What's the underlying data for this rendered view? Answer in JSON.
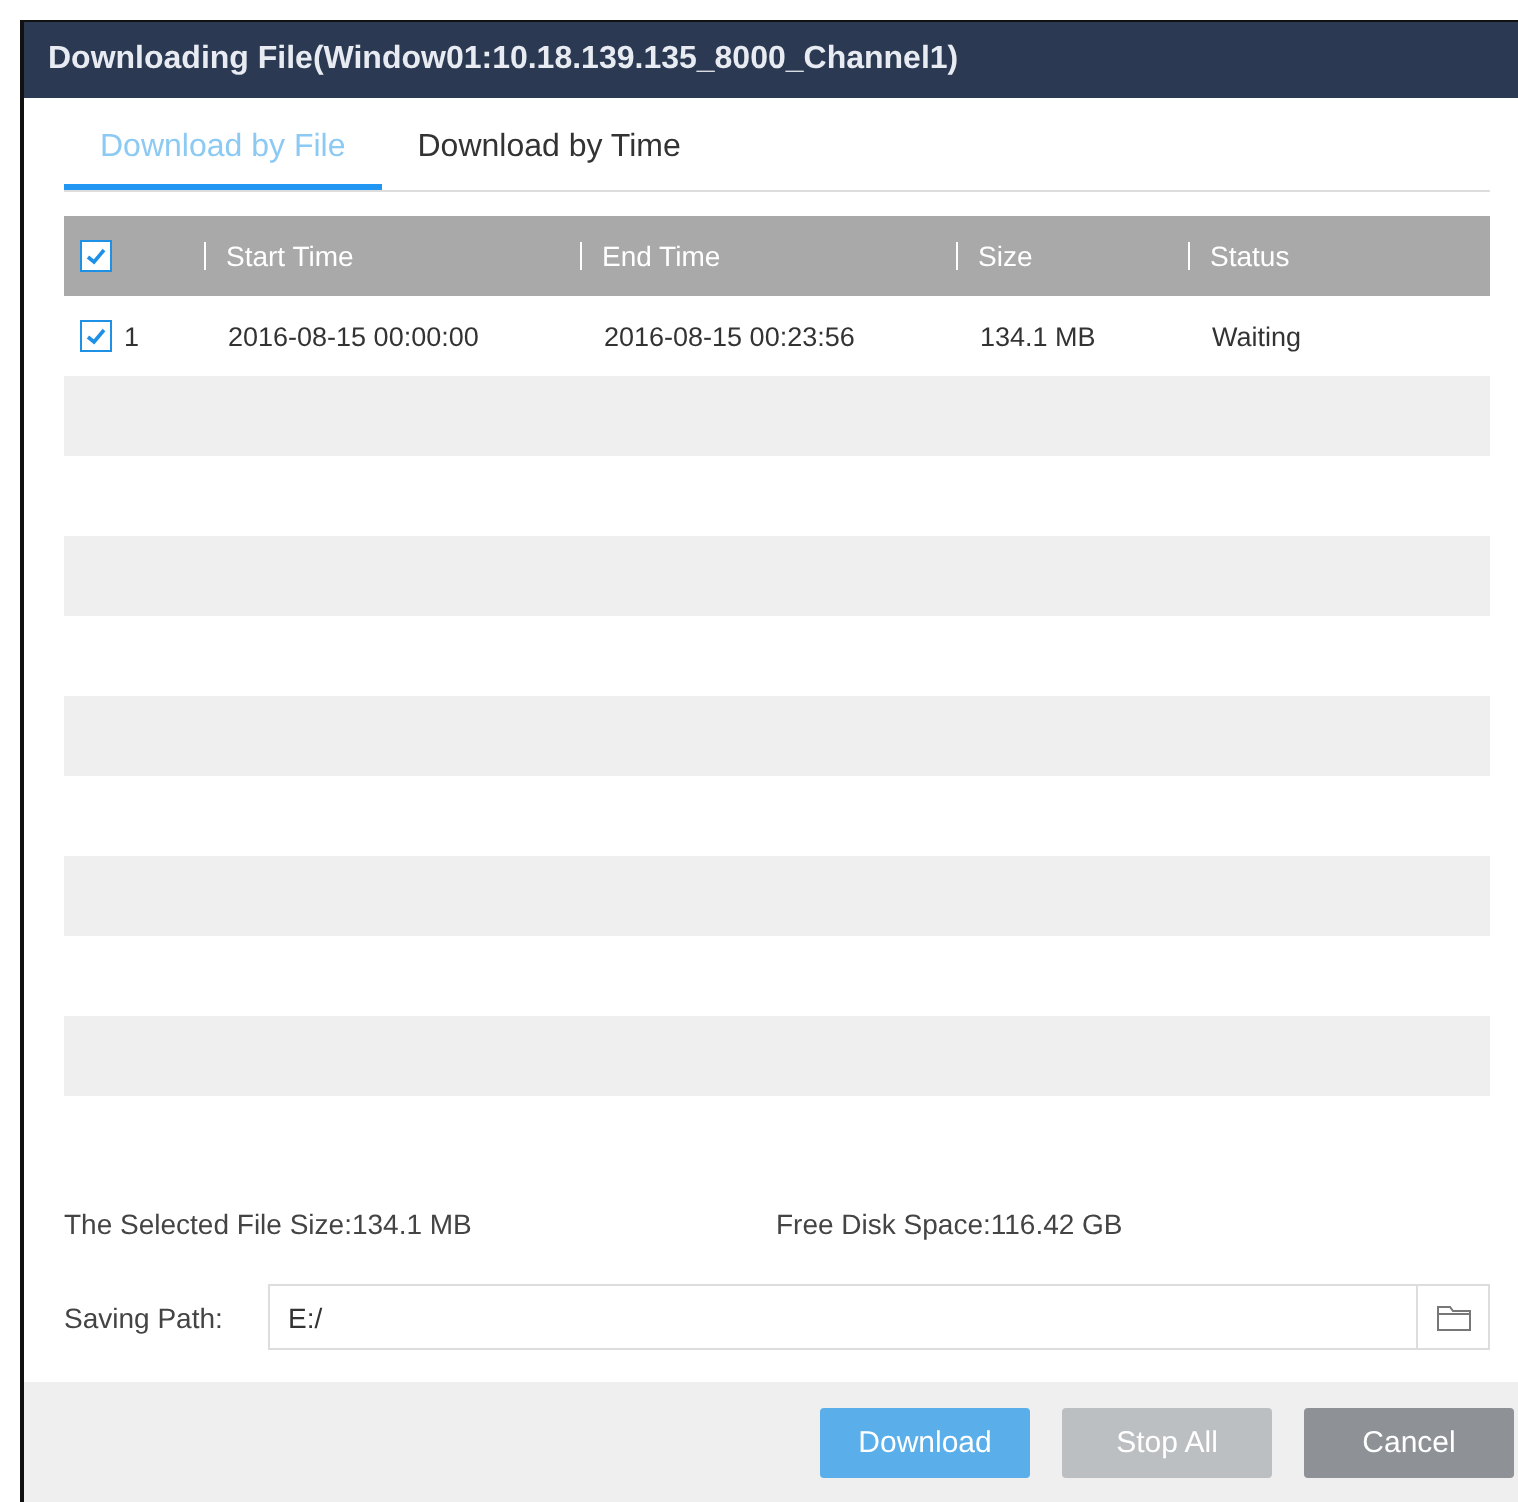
{
  "window": {
    "title": "Downloading File(Window01:10.18.139.135_8000_Channel1)"
  },
  "tabs": [
    {
      "label": "Download by File",
      "selected": true
    },
    {
      "label": "Download by Time",
      "selected": false
    }
  ],
  "table": {
    "header_checked": true,
    "columns": [
      "Start Time",
      "End Time",
      "Size",
      "Status"
    ],
    "rows": [
      {
        "checked": true,
        "index": "1",
        "start": "2016-08-15 00:00:00",
        "end": "2016-08-15 00:23:56",
        "size": "134.1 MB",
        "status": "Waiting"
      }
    ]
  },
  "selected_size": "The Selected File Size:134.1 MB",
  "free_space": "Free Disk Space:116.42 GB",
  "saving_path": {
    "label": "Saving Path:",
    "value": "E:/"
  },
  "buttons": [
    {
      "label": "Download",
      "kind": "primary"
    },
    {
      "label": "Stop All",
      "kind": "disabled"
    },
    {
      "label": "Cancel",
      "kind": "secondary"
    }
  ]
}
